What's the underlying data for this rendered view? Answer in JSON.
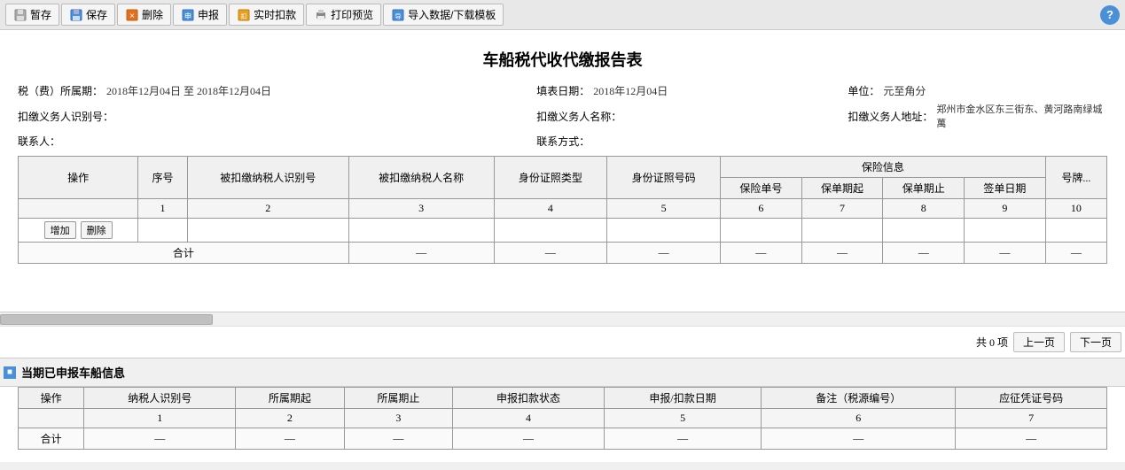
{
  "toolbar": {
    "buttons": [
      {
        "id": "temp-save",
        "label": "暂存",
        "icon": "💾",
        "color": "#999"
      },
      {
        "id": "save",
        "label": "保存",
        "icon": "💾",
        "color": "#4a90d9"
      },
      {
        "id": "delete",
        "label": "删除",
        "icon": "🗑",
        "color": "#e07020"
      },
      {
        "id": "submit",
        "label": "申报",
        "icon": "📋",
        "color": "#4a90d9"
      },
      {
        "id": "realtime-pay",
        "label": "实时扣款",
        "icon": "💳",
        "color": "#e8a020"
      },
      {
        "id": "print",
        "label": "打印预览",
        "icon": "🖨",
        "color": "#999"
      },
      {
        "id": "import",
        "label": "导入数据/下载模板",
        "icon": "📥",
        "color": "#4a90d9"
      }
    ],
    "help_label": "?"
  },
  "report": {
    "title": "车船税代收代缴报告表",
    "info": {
      "tax_period_label": "税（费）所属期：",
      "tax_period_value": "2018年12月04日 至 2018年12月04日",
      "fill_date_label": "填表日期：",
      "fill_date_value": "2018年12月04日",
      "unit_label": "单位：",
      "unit_value": "元至角分",
      "withhold_id_label": "扣缴义务人识别号：",
      "withhold_id_value": "",
      "withhold_name_label": "扣缴义务人名称：",
      "withhold_name_value": "",
      "address_label": "扣缴义务人地址：",
      "address_value": "郑州市金水区东三街东、黄河路南绿城萬",
      "contact_label": "联系人：",
      "contact_value": "",
      "contact_method_label": "联系方式：",
      "contact_method_value": ""
    },
    "table": {
      "headers_row1": [
        {
          "label": "操作",
          "rowspan": 2,
          "colspan": 1
        },
        {
          "label": "序号",
          "rowspan": 2,
          "colspan": 1
        },
        {
          "label": "被扣缴纳税人识别号",
          "rowspan": 2,
          "colspan": 1
        },
        {
          "label": "被扣缴纳税人名称",
          "rowspan": 2,
          "colspan": 1
        },
        {
          "label": "身份证照类型",
          "rowspan": 2,
          "colspan": 1
        },
        {
          "label": "身份证照号码",
          "rowspan": 2,
          "colspan": 1
        },
        {
          "label": "保险信息",
          "rowspan": 1,
          "colspan": 4
        },
        {
          "label": "号牌...",
          "rowspan": 2,
          "colspan": 1
        }
      ],
      "headers_row2": [
        {
          "label": "保险单号"
        },
        {
          "label": "保单期起"
        },
        {
          "label": "保单期止"
        },
        {
          "label": "签单日期"
        }
      ],
      "col_numbers": [
        "1",
        "2",
        "3",
        "4",
        "5",
        "6",
        "7",
        "8",
        "9",
        "10"
      ],
      "add_btn": "增加",
      "delete_btn": "删除",
      "total_row": {
        "label": "合计",
        "values": [
          "—",
          "—",
          "—",
          "—",
          "—",
          "—",
          "—"
        ]
      }
    },
    "pagination": {
      "total_label": "共 0 项",
      "prev_label": "上一页",
      "next_label": "下一页"
    }
  },
  "section2": {
    "icon_text": "当",
    "title": "当期已申报车船信息",
    "table": {
      "headers": [
        "操作",
        "纳税人识别号",
        "所属期起",
        "所属期止",
        "申报扣款状态",
        "申报/扣款日期",
        "备注（税源编号）",
        "应征凭证号码"
      ],
      "col_numbers": [
        "",
        "1",
        "2",
        "3",
        "4",
        "5",
        "6",
        "7"
      ],
      "total_row": {
        "label": "合计",
        "values": [
          "—",
          "—",
          "—",
          "—",
          "—",
          "—",
          "—"
        ]
      }
    }
  }
}
